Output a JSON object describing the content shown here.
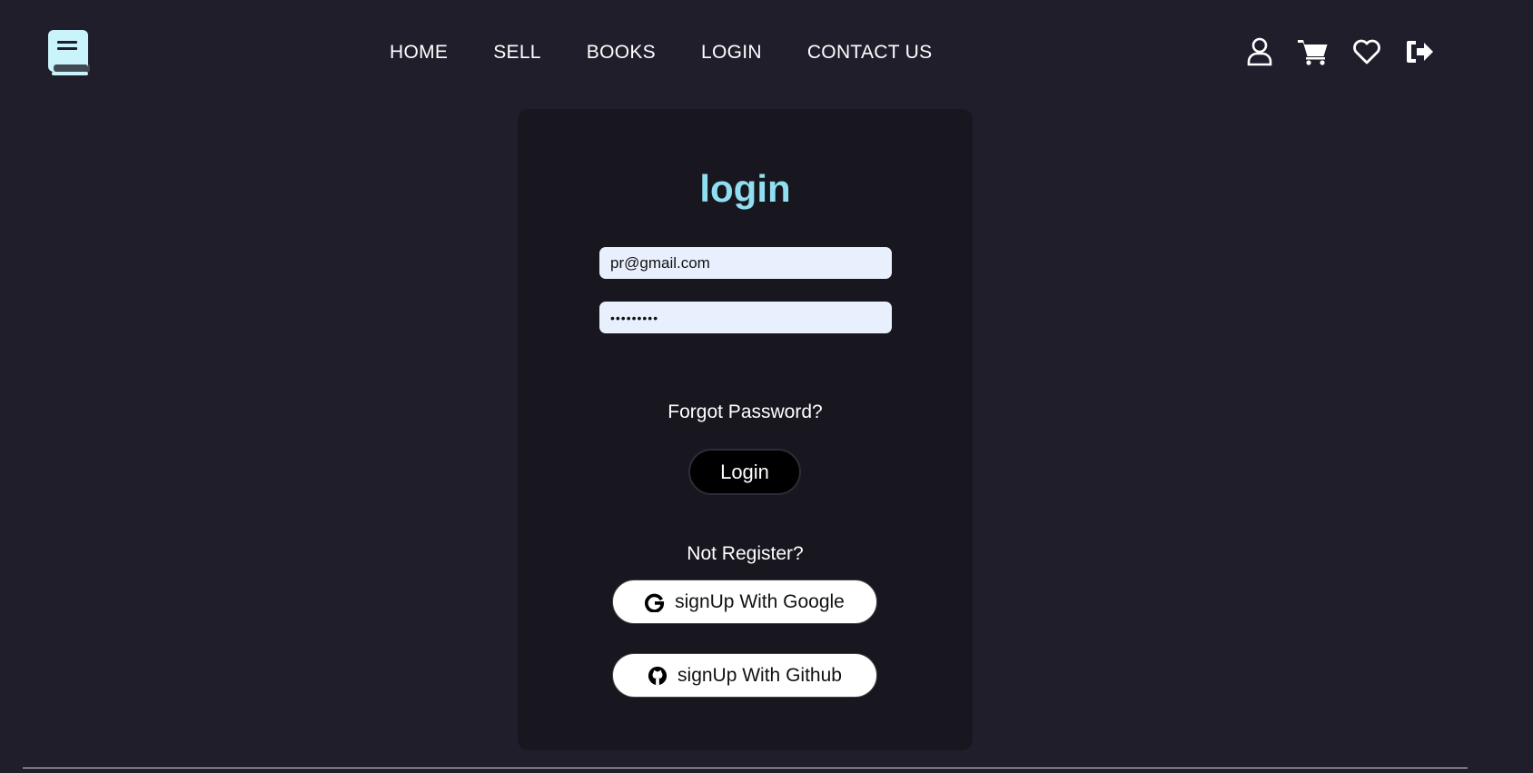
{
  "header": {
    "logo_icon": "book-icon",
    "nav": [
      {
        "label": "HOME"
      },
      {
        "label": "SELL"
      },
      {
        "label": "BOOKS"
      },
      {
        "label": "LOGIN"
      },
      {
        "label": "CONTACT US"
      }
    ],
    "icons": [
      "user-icon",
      "cart-icon",
      "heart-icon",
      "logout-icon"
    ]
  },
  "login": {
    "title": "login",
    "email_value": "pr@gmail.com",
    "password_value": "•••••••••",
    "forgot_label": "Forgot Password?",
    "login_button": "Login",
    "not_register_label": "Not Register?",
    "google_button": "signUp With Google",
    "github_button": "signUp With Github"
  },
  "colors": {
    "background": "#201e2b",
    "card": "#18161f",
    "accent": "#8fdff0",
    "input": "#e8f0fe"
  }
}
